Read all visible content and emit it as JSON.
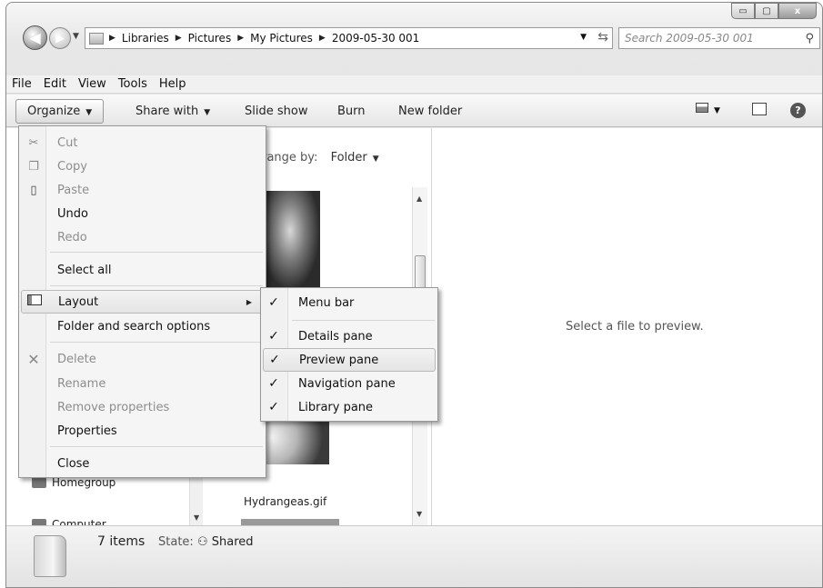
{
  "window": {
    "caption_buttons": {
      "minimize": "▭",
      "maximize": "▢",
      "close": "x"
    }
  },
  "address": {
    "back_icon": "back-arrow-icon",
    "breadcrumbs": [
      "Libraries",
      "Pictures",
      "My Pictures",
      "2009-05-30 001"
    ],
    "separator": "▶",
    "search_placeholder": "Search 2009-05-30 001"
  },
  "menubar": {
    "items": [
      "File",
      "Edit",
      "View",
      "Tools",
      "Help"
    ]
  },
  "commandbar": {
    "organize": "Organize",
    "share_with": "Share with",
    "slide_show": "Slide show",
    "burn": "Burn",
    "new_folder": "New folder"
  },
  "file_pane": {
    "arrange_label": "rrange by:",
    "arrange_value": "Folder",
    "file_label": "Hydrangeas.gif"
  },
  "nav_pane": {
    "items": [
      "Homegroup",
      "Computer"
    ]
  },
  "preview": {
    "message": "Select a file to preview."
  },
  "details": {
    "count": "7 items",
    "state_label": "State:",
    "state_value": "Shared"
  },
  "organize_menu": {
    "cut": "Cut",
    "copy": "Copy",
    "paste": "Paste",
    "undo": "Undo",
    "redo": "Redo",
    "select_all": "Select all",
    "layout": "Layout",
    "folder_options": "Folder and search options",
    "delete": "Delete",
    "rename": "Rename",
    "remove_properties": "Remove properties",
    "properties": "Properties",
    "close": "Close"
  },
  "layout_submenu": {
    "menu_bar": {
      "label": "Menu bar",
      "checked": true
    },
    "details_pane": {
      "label": "Details pane",
      "checked": true
    },
    "preview_pane": {
      "label": "Preview pane",
      "checked": true
    },
    "navigation_pane": {
      "label": "Navigation pane",
      "checked": true
    },
    "library_pane": {
      "label": "Library pane",
      "checked": true
    },
    "check_glyph": "✓"
  }
}
